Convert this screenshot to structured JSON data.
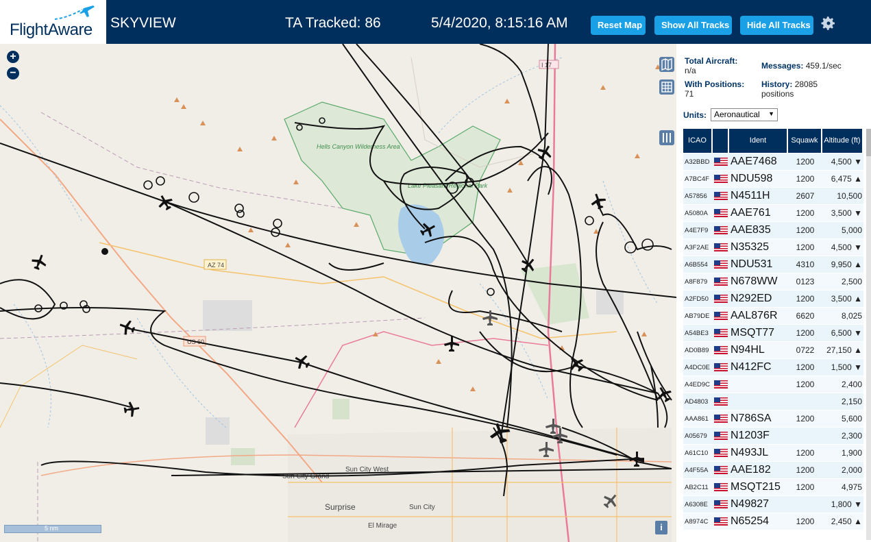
{
  "header": {
    "brand": "FlightAware",
    "app_title": "SKYVIEW",
    "tracked": "TA Tracked: 86",
    "datetime": "5/4/2020, 8:15:16 AM",
    "buttons": {
      "reset": "Reset Map",
      "show": "Show All Tracks",
      "hide": "Hide All Tracks"
    },
    "accent_color": "#1aa0e6",
    "bar_color": "#002f5d"
  },
  "map": {
    "zoom_in": "+",
    "zoom_out": "−",
    "info": "i",
    "scale": "5 nm",
    "labels": {
      "wilderness": "Hells Canyon Wilderness Area",
      "park": "Lake Pleasant Regional Park",
      "az74": "AZ 74",
      "us60": "US 60",
      "i17": "I 17",
      "sun_city_grand": "Sun City Grand",
      "sun_city_west": "Sun City West",
      "surprise": "Surprise",
      "sun_city": "Sun City",
      "el_mirage": "El Mirage"
    }
  },
  "stats": {
    "total_label": "Total Aircraft:",
    "total_value": "n/a",
    "positions_label": "With Positions:",
    "positions_value": "71",
    "messages_label": "Messages:",
    "messages_value": "459.1/sec",
    "history_label": "History:",
    "history_value": "28085 positions",
    "units_label": "Units:",
    "units_value": "Aeronautical"
  },
  "table": {
    "headers": {
      "icao": "ICAO",
      "ident": "Ident",
      "squawk": "Squawk",
      "altitude": "Altitude (ft)"
    },
    "rows": [
      {
        "icao": "A32BBD",
        "ident": "AAE7468",
        "squawk": "1200",
        "alt": "4,500 ▼"
      },
      {
        "icao": "A7BC4F",
        "ident": "NDU598",
        "squawk": "1200",
        "alt": "6,475 ▲"
      },
      {
        "icao": "A57856",
        "ident": "N4511H",
        "squawk": "2607",
        "alt": "10,500"
      },
      {
        "icao": "A5080A",
        "ident": "AAE761",
        "squawk": "1200",
        "alt": "3,500 ▼"
      },
      {
        "icao": "A4E7F9",
        "ident": "AAE835",
        "squawk": "1200",
        "alt": "5,000"
      },
      {
        "icao": "A3F2AE",
        "ident": "N35325",
        "squawk": "1200",
        "alt": "4,500 ▼"
      },
      {
        "icao": "A6B554",
        "ident": "NDU531",
        "squawk": "4310",
        "alt": "9,950 ▲"
      },
      {
        "icao": "A8F879",
        "ident": "N678WW",
        "squawk": "0123",
        "alt": "2,500"
      },
      {
        "icao": "A2FD50",
        "ident": "N292ED",
        "squawk": "1200",
        "alt": "3,500 ▲"
      },
      {
        "icao": "AB79DE",
        "ident": "AAL876R",
        "squawk": "6620",
        "alt": "8,025"
      },
      {
        "icao": "A54BE3",
        "ident": "MSQT77",
        "squawk": "1200",
        "alt": "6,500 ▼"
      },
      {
        "icao": "AD0B89",
        "ident": "N94HL",
        "squawk": "0722",
        "alt": "27,150 ▲"
      },
      {
        "icao": "A4DC0E",
        "ident": "N412FC",
        "squawk": "1200",
        "alt": "1,500 ▼"
      },
      {
        "icao": "A4ED9C",
        "ident": "",
        "squawk": "1200",
        "alt": "2,400"
      },
      {
        "icao": "AD4803",
        "ident": "",
        "squawk": "",
        "alt": "2,150"
      },
      {
        "icao": "AAA861",
        "ident": "N786SA",
        "squawk": "1200",
        "alt": "5,600"
      },
      {
        "icao": "A05679",
        "ident": "N1203F",
        "squawk": "",
        "alt": "2,300"
      },
      {
        "icao": "A61C10",
        "ident": "N493JL",
        "squawk": "1200",
        "alt": "1,900"
      },
      {
        "icao": "A4F55A",
        "ident": "AAE182",
        "squawk": "1200",
        "alt": "2,000"
      },
      {
        "icao": "AB2C11",
        "ident": "MSQT215",
        "squawk": "1200",
        "alt": "4,975"
      },
      {
        "icao": "A6308E",
        "ident": "N49827",
        "squawk": "",
        "alt": "1,800 ▼"
      },
      {
        "icao": "A8974C",
        "ident": "N65254",
        "squawk": "1200",
        "alt": "2,450 ▲"
      }
    ]
  }
}
